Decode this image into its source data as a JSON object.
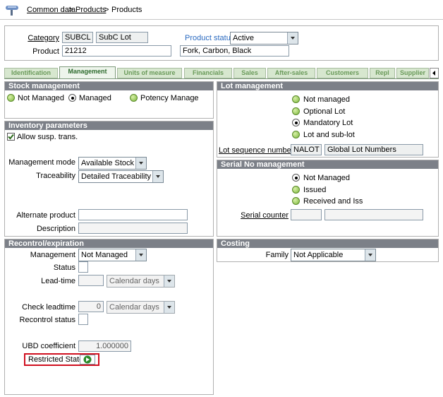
{
  "breadcrumb": {
    "a": "Common data",
    "sep1": ">",
    "b": "Products",
    "sep2": ">",
    "c": "Products"
  },
  "header": {
    "category_label": "Category",
    "category_code": "SUBCL",
    "category_desc": "SubC Lot",
    "product_status_label": "Product status",
    "product_status_value": "Active",
    "product_label": "Product",
    "product_code": "21212",
    "product_desc": "Fork, Carbon, Black"
  },
  "tabs": [
    "Identification",
    "Management",
    "Units of measure",
    "Financials",
    "Sales",
    "After-sales",
    "Customers",
    "Repl",
    "Supplier"
  ],
  "stock_management": {
    "title": "Stock management",
    "options": [
      "Not Managed",
      "Managed",
      "Potency Manage"
    ]
  },
  "inventory": {
    "title": "Inventory parameters",
    "allow_susp": "Allow susp. trans.",
    "management_mode_label": "Management mode",
    "management_mode_value": "Available Stock",
    "traceability_label": "Traceability",
    "traceability_value": "Detailed Traceability",
    "alternate_product_label": "Alternate product",
    "description_label": "Description"
  },
  "recontrol": {
    "title": "Recontrol/expiration",
    "management_label": "Management",
    "management_value": "Not Managed",
    "status_label": "Status",
    "leadtime_label": "Lead-time",
    "leadtime_unit": "Calendar days",
    "check_leadtime_label": "Check leadtime",
    "check_leadtime_value": "0",
    "check_leadtime_unit": "Calendar days",
    "recontrol_status_label": "Recontrol status",
    "ubd_label": "UBD coefficient",
    "ubd_value": "1.000000",
    "restricted_state_label": "Restricted State"
  },
  "lot_management": {
    "title": "Lot management",
    "options": [
      "Not managed",
      "Optional Lot",
      "Mandatory Lot",
      "Lot and sub-lot"
    ],
    "lot_seq_label": "Lot sequence number",
    "lot_seq_code": "NALOT",
    "lot_seq_desc": "Global Lot Numbers"
  },
  "serial": {
    "title": "Serial No management",
    "options": [
      "Not Managed",
      "Issued",
      "Received and Iss"
    ],
    "counter_label": "Serial counter"
  },
  "costing": {
    "title": "Costing",
    "family_label": "Family",
    "family_value": "Not Applicable"
  },
  "colors": {
    "panel_header": "#7c8088",
    "tab_bg": "#d7e7cf",
    "tab_text": "#6a9a5a",
    "highlight": "#d01020"
  }
}
